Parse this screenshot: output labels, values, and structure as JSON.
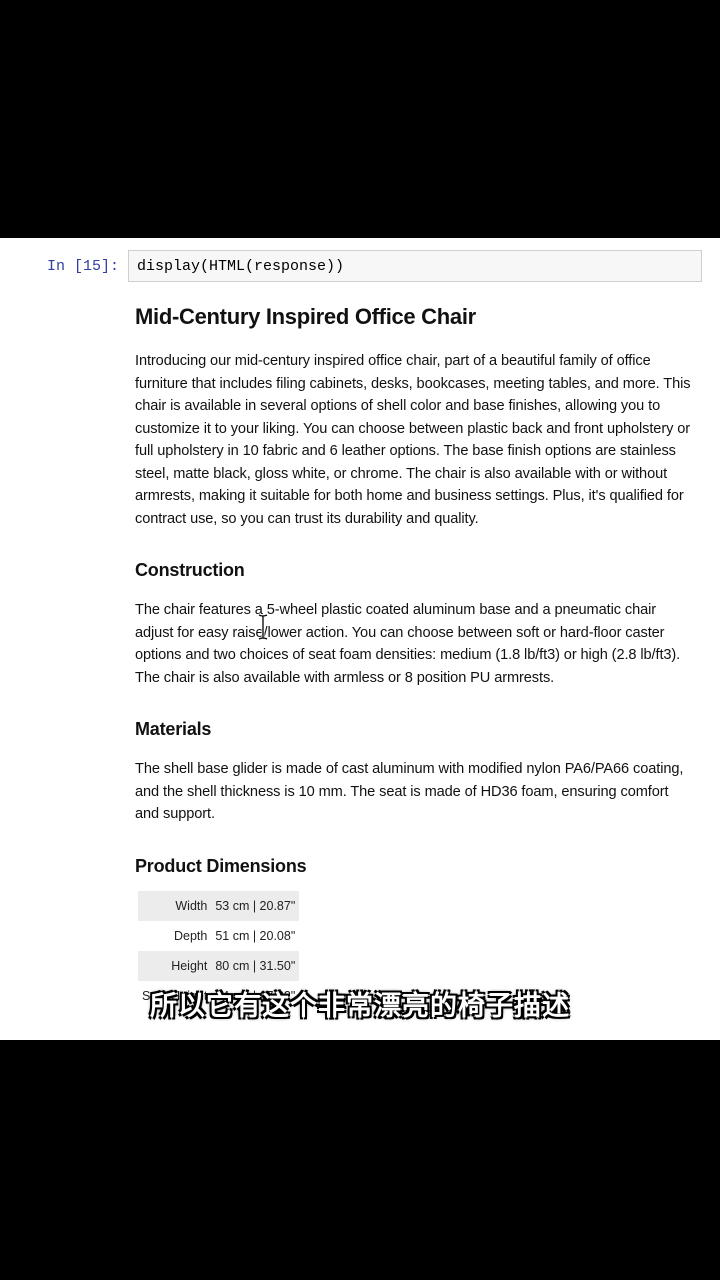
{
  "notebook": {
    "prompt": "In [15]:",
    "code": "display(HTML(response))"
  },
  "article": {
    "title": "Mid-Century Inspired Office Chair",
    "intro": "Introducing our mid-century inspired office chair, part of a beautiful family of office furniture that includes filing cabinets, desks, bookcases, meeting tables, and more. This chair is available in several options of shell color and base finishes, allowing you to customize it to your liking. You can choose between plastic back and front upholstery or full upholstery in 10 fabric and 6 leather options. The base finish options are stainless steel, matte black, gloss white, or chrome. The chair is also available with or without armrests, making it suitable for both home and business settings. Plus, it's qualified for contract use, so you can trust its durability and quality.",
    "construction": {
      "heading": "Construction",
      "text": "The chair features a 5-wheel plastic coated aluminum base and a pneumatic chair adjust for easy raise/lower action. You can choose between soft or hard-floor caster options and two choices of seat foam densities: medium (1.8 lb/ft3) or high (2.8 lb/ft3). The chair is also available with armless or 8 position PU armrests."
    },
    "materials": {
      "heading": "Materials",
      "text": "The shell base glider is made of cast aluminum with modified nylon PA6/PA66 coating, and the shell thickness is 10 mm. The seat is made of HD36 foam, ensuring comfort and support."
    },
    "dimensions": {
      "heading": "Product Dimensions",
      "rows": [
        {
          "label": "Width",
          "value": "53 cm | 20.87\""
        },
        {
          "label": "Depth",
          "value": "51 cm | 20.08\""
        },
        {
          "label": "Height",
          "value": "80 cm | 31.50\""
        },
        {
          "label": "Seat Height",
          "value": "44 cm | 17.32\""
        }
      ]
    }
  },
  "subtitle": "所以它有这个非常漂亮的椅子描述",
  "icons": {
    "text_caret": "i-beam-cursor-icon"
  }
}
